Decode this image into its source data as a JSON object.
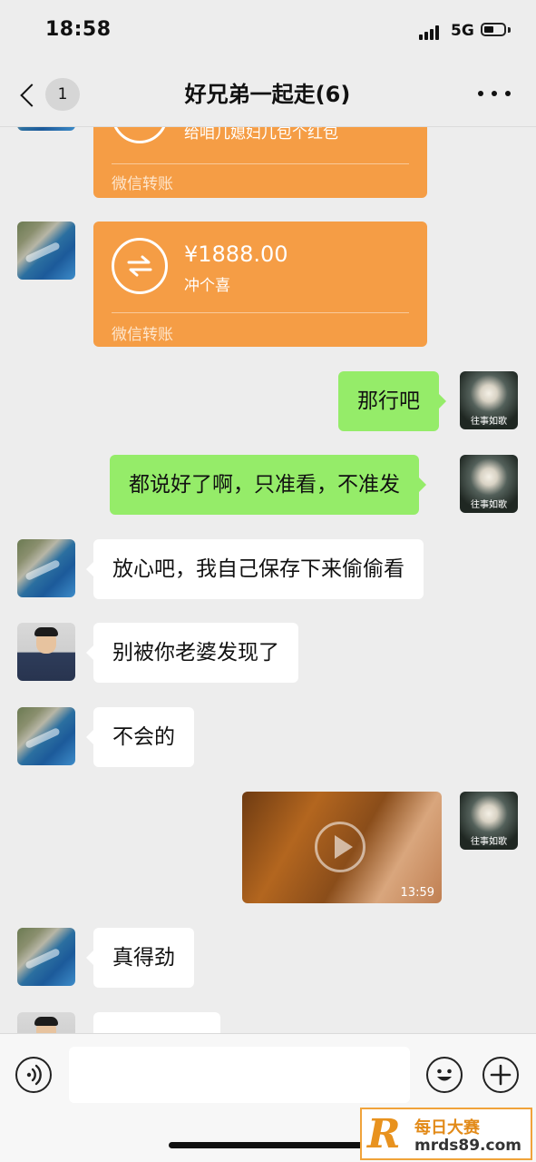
{
  "status": {
    "time": "18:58",
    "network": "5G"
  },
  "nav": {
    "unread_count": "1",
    "title": "好兄弟一起走(6)"
  },
  "messages": {
    "transfer_1": {
      "note": "给咱几媳妇儿包个红包",
      "footer": "微信转账"
    },
    "transfer_2": {
      "amount": "¥1888.00",
      "note": "冲个喜",
      "footer": "微信转账"
    },
    "sent_1": "那行吧",
    "sent_2": "都说好了啊，只准看，不准发",
    "recv_1": "放心吧，我自己保存下来偷偷看",
    "recv_2": "别被你老婆发现了",
    "recv_3": "不会的",
    "video": {
      "duration": "13:59"
    },
    "recv_4": "真得劲"
  },
  "avatars": {
    "flower_label": "往事如歌"
  },
  "input": {
    "placeholder": ""
  },
  "watermark": {
    "logo": "R",
    "name": "每日大赛",
    "url": "mrds89.com"
  },
  "colors": {
    "background": "#ededed",
    "sent_bubble": "#95ec69",
    "transfer_card": "#f59d45",
    "received_bubble": "#ffffff"
  },
  "icons": [
    "back-icon",
    "more-icon",
    "transfer-icon",
    "play-icon",
    "voice-icon",
    "emoji-icon",
    "add-icon"
  ]
}
